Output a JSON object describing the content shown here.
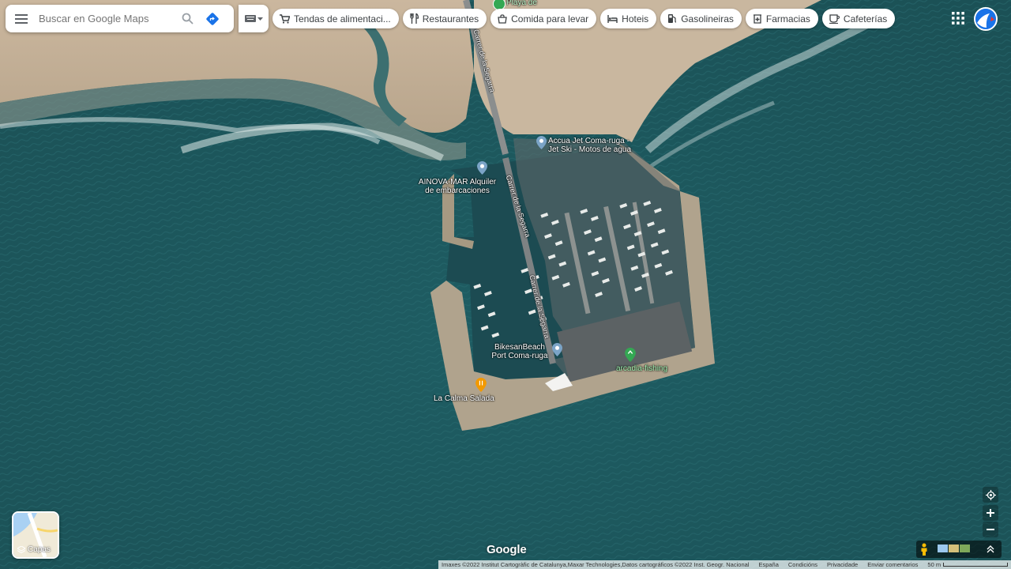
{
  "search": {
    "placeholder": "Buscar en Google Maps"
  },
  "chips": [
    {
      "icon": "cart-icon",
      "label": "Tendas de alimentaci..."
    },
    {
      "icon": "fork-knife-icon",
      "label": "Restaurantes"
    },
    {
      "icon": "takeout-bag-icon",
      "label": "Comida para levar"
    },
    {
      "icon": "bed-icon",
      "label": "Hoteis"
    },
    {
      "icon": "fuel-pump-icon",
      "label": "Gasolineiras"
    },
    {
      "icon": "pharmacy-icon",
      "label": "Farmacias"
    },
    {
      "icon": "coffee-cup-icon",
      "label": "Cafeterías"
    }
  ],
  "map": {
    "roads": [
      "Carrer de la Segarra",
      "Carrer de la Segarra",
      "Carrer de la Segarra"
    ],
    "pois": [
      {
        "name": "Playa de",
        "color": "#34a853"
      },
      {
        "name_line1": "Accua Jet Coma-ruga -",
        "name_line2": "Jet Ski - Motos de agua"
      },
      {
        "name_line1": "AINOVA-MAR Alquiler",
        "name_line2": "de embarcaciones"
      },
      {
        "name_line1": "BikesanBeach",
        "name_line2": "Port Coma-ruga"
      },
      {
        "name": "arcadia-fishing",
        "color": "#34a853"
      },
      {
        "name": "La Calma Salada",
        "color": "#f29900"
      }
    ]
  },
  "layers": {
    "label": "Capas"
  },
  "logo": "Google",
  "footer": {
    "attribution": "Imaxes ©2022 Institut Cartogràfic de Catalunya,Maxar Technologies,Datos cartográficos ©2022 Inst. Geogr. Nacional",
    "country": "España",
    "terms": "Condicións",
    "privacy": "Privacidade",
    "feedback": "Enviar comentarios",
    "scale": "50 m"
  }
}
